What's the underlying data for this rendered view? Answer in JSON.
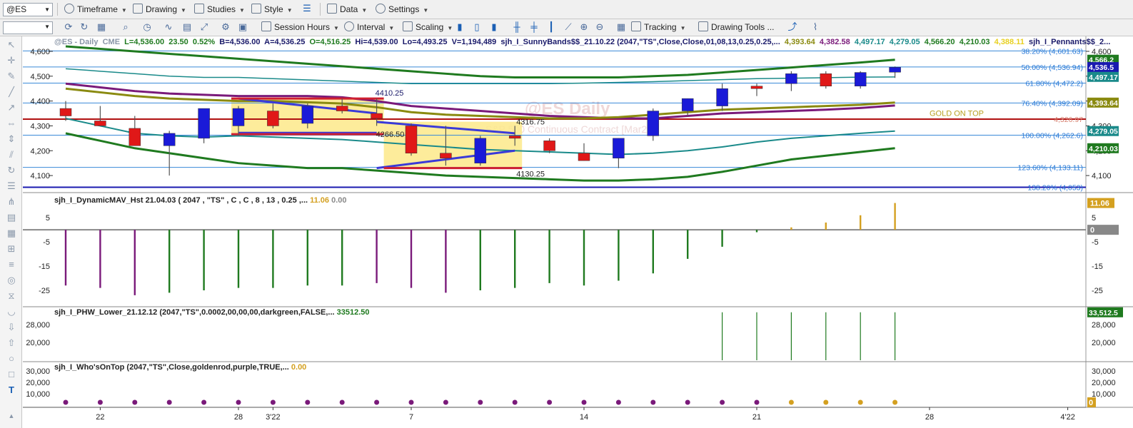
{
  "toolbar1": {
    "symbol": "@ES",
    "items": [
      {
        "label": "Timeframe",
        "icon": "clock-icon"
      },
      {
        "label": "Drawing",
        "icon": "pencil-icon"
      },
      {
        "label": "Studies",
        "icon": "studies-icon"
      },
      {
        "label": "Style",
        "icon": "palette-icon"
      },
      {
        "label": "Data",
        "icon": "data-icon"
      },
      {
        "label": "Settings",
        "icon": "gear-icon"
      }
    ]
  },
  "toolbar2": {
    "session_hours": "Session Hours",
    "interval": "Interval",
    "scaling": "Scaling",
    "tracking": "Tracking",
    "drawing_tools": "Drawing Tools ..."
  },
  "status": {
    "symbol": "@ES - Daily",
    "exchange": "CME",
    "last": "L=4,536.00",
    "change": "23.50",
    "change_pct": "0.52%",
    "bid": "B=4,536.00",
    "ask": "A=4,536.25",
    "open": "O=4,516.25",
    "high": "Hi=4,539.00",
    "low": "Lo=4,493.25",
    "volume": "V=1,194,489",
    "study": "sjh_I_SunnyBands$$_21.10.22 (2047,\"TS\",Close,Close,01,08,13,0.25,0.25,...",
    "v1": "4,393.64",
    "v2": "4,382.58",
    "v3": "4,497.17",
    "v4": "4,279.05",
    "v5": "4,566.20",
    "v6": "4,210.03",
    "v7": "4,388.11",
    "study2": "sjh_I_Pennants$$_2..."
  },
  "watermark": {
    "title": "@ES Daily",
    "subtitle": "S&P 500 Continuous Contract [Mar22]"
  },
  "annotations": {
    "a1": "4410.25",
    "a2": "4316.75",
    "a3": "4266.50",
    "a4": "4130.25",
    "gold": "GOLD ON TOP"
  },
  "fib": [
    {
      "label": "38.20% (4,601.63)",
      "price": 4601.63
    },
    {
      "label": "50.00% (4,536.94)",
      "price": 4536.94
    },
    {
      "label": "61.80% (4,472.2)",
      "price": 4472.2
    },
    {
      "label": "76.40% (4,392.09)",
      "price": 4392.09
    },
    {
      "label": "100.00% (4,262.6)",
      "price": 4262.6
    },
    {
      "label": "123.60% (4,133.11)",
      "price": 4133.11
    },
    {
      "label": "138.20% (4,053)",
      "price": 4053
    }
  ],
  "price_axis": {
    "ticks": [
      "4,600",
      "4,500",
      "4,400",
      "4,300",
      "4,200",
      "4,100"
    ],
    "values": [
      4600,
      4500,
      4400,
      4300,
      4200,
      4100
    ],
    "min": 4040,
    "max": 4620
  },
  "red_line": {
    "label": "4,326.97",
    "price": 4326.97
  },
  "axis_badges": [
    {
      "text": "4,566.2",
      "price": 4566.2,
      "color": "#1f7a1f"
    },
    {
      "text": "4,536.5",
      "price": 4536.5,
      "color": "#1a1ab0"
    },
    {
      "text": "4,497.17",
      "price": 4497.17,
      "color": "#1a8a8a"
    },
    {
      "text": "4,393.64",
      "price": 4393.64,
      "color": "#8a8a10"
    },
    {
      "text": "4,279.05",
      "price": 4279.05,
      "color": "#1a8a8a"
    },
    {
      "text": "4,210.03",
      "price": 4210.03,
      "color": "#1f7a1f"
    }
  ],
  "candles": [
    {
      "o": 4370,
      "h": 4400,
      "l": 4320,
      "c": 4340
    },
    {
      "o": 4320,
      "h": 4380,
      "l": 4300,
      "c": 4300
    },
    {
      "o": 4290,
      "h": 4340,
      "l": 4220,
      "c": 4220
    },
    {
      "o": 4220,
      "h": 4280,
      "l": 4100,
      "c": 4270
    },
    {
      "o": 4250,
      "h": 4360,
      "l": 4230,
      "c": 4370
    },
    {
      "o": 4300,
      "h": 4380,
      "l": 4260,
      "c": 4370
    },
    {
      "o": 4360,
      "h": 4390,
      "l": 4290,
      "c": 4300
    },
    {
      "o": 4310,
      "h": 4390,
      "l": 4290,
      "c": 4380
    },
    {
      "o": 4380,
      "h": 4410,
      "l": 4350,
      "c": 4360
    },
    {
      "o": 4350,
      "h": 4410,
      "l": 4300,
      "c": 4330
    },
    {
      "o": 4300,
      "h": 4310,
      "l": 4180,
      "c": 4190
    },
    {
      "o": 4190,
      "h": 4300,
      "l": 4140,
      "c": 4170
    },
    {
      "o": 4150,
      "h": 4260,
      "l": 4140,
      "c": 4250
    },
    {
      "o": 4260,
      "h": 4300,
      "l": 4220,
      "c": 4250
    },
    {
      "o": 4240,
      "h": 4250,
      "l": 4190,
      "c": 4200
    },
    {
      "o": 4190,
      "h": 4230,
      "l": 4160,
      "c": 4160
    },
    {
      "o": 4170,
      "h": 4250,
      "l": 4130,
      "c": 4250
    },
    {
      "o": 4260,
      "h": 4370,
      "l": 4240,
      "c": 4360
    },
    {
      "o": 4360,
      "h": 4410,
      "l": 4340,
      "c": 4410
    },
    {
      "o": 4380,
      "h": 4470,
      "l": 4360,
      "c": 4450
    },
    {
      "o": 4460,
      "h": 4470,
      "l": 4420,
      "c": 4450
    },
    {
      "o": 4470,
      "h": 4520,
      "l": 4440,
      "c": 4510
    },
    {
      "o": 4510,
      "h": 4520,
      "l": 4450,
      "c": 4460
    },
    {
      "o": 4460,
      "h": 4520,
      "l": 4450,
      "c": 4515
    },
    {
      "o": 4516,
      "h": 4539,
      "l": 4493,
      "c": 4536
    }
  ],
  "x_axis": {
    "labels": [
      "22",
      "28",
      "3'22",
      "7",
      "14",
      "21",
      "28",
      "4'22"
    ],
    "bar_index": [
      1,
      5,
      6,
      10,
      15,
      20,
      25,
      29
    ]
  },
  "panels": {
    "mav": {
      "label": "sjh_I_DynamicMAV_Hst 21.04.03 ( 2047 , \"TS\" , C , C ,  8 , 13 , 0.25 ,...",
      "value": "11.06",
      "value2": "0.00",
      "ticks": [
        "5",
        "-5",
        "-15",
        "-25"
      ],
      "tick_values": [
        5,
        -5,
        -15,
        -25
      ],
      "min": -30,
      "max": 13,
      "badge1": "11.06",
      "badge2": "0",
      "bars": [
        -23,
        -24,
        -27,
        -26,
        -25,
        -24,
        -24,
        -23,
        -23,
        -22,
        -24,
        -26,
        -25,
        -24,
        -22,
        -23,
        -21,
        -18,
        -12,
        -7,
        -1,
        1,
        3,
        6,
        11.06
      ],
      "colors": [
        "#7a1a7a",
        "#7a1a7a",
        "#7a1a7a",
        "#1f7a1f",
        "#1f7a1f",
        "#1f7a1f",
        "#1f7a1f",
        "#1f7a1f",
        "#1f7a1f",
        "#7a1a7a",
        "#7a1a7a",
        "#7a1a7a",
        "#1f7a1f",
        "#1f7a1f",
        "#1f7a1f",
        "#1f7a1f",
        "#1f7a1f",
        "#1f7a1f",
        "#1f7a1f",
        "#1f7a1f",
        "#1f7a1f",
        "#d4a020",
        "#d4a020",
        "#d4a020",
        "#d4a020"
      ]
    },
    "phw": {
      "label": "sjh_I_PHW_Lower_21.12.12 (2047,\"TS\",0.0002,00,00,00,darkgreen,FALSE,...",
      "value": "33512.50",
      "ticks": [
        "28,000",
        "20,000"
      ],
      "tick_values": [
        28000,
        20000
      ],
      "min": 12000,
      "max": 36000,
      "badge": "33,512.5",
      "bars": [
        0,
        0,
        0,
        0,
        0,
        0,
        0,
        0,
        0,
        0,
        0,
        0,
        0,
        0,
        0,
        0,
        0,
        0,
        0,
        33512,
        33512,
        33512,
        33512,
        33512,
        33512
      ]
    },
    "who": {
      "label": "sjh_I_Who'sOnTop (2047,\"TS\",Close,goldenrod,purple,TRUE,...",
      "value": "0.00",
      "ticks": [
        "30,000",
        "20,000",
        "10,000"
      ],
      "tick_values": [
        30000,
        20000,
        10000
      ],
      "min": 0,
      "max": 38000,
      "badge": "0",
      "dot_colors": [
        "#7a1a7a",
        "#7a1a7a",
        "#7a1a7a",
        "#7a1a7a",
        "#7a1a7a",
        "#7a1a7a",
        "#7a1a7a",
        "#7a1a7a",
        "#7a1a7a",
        "#7a1a7a",
        "#7a1a7a",
        "#7a1a7a",
        "#7a1a7a",
        "#7a1a7a",
        "#7a1a7a",
        "#7a1a7a",
        "#7a1a7a",
        "#7a1a7a",
        "#7a1a7a",
        "#7a1a7a",
        "#7a1a7a",
        "#d4a020",
        "#d4a020",
        "#d4a020",
        "#d4a020"
      ]
    }
  }
}
